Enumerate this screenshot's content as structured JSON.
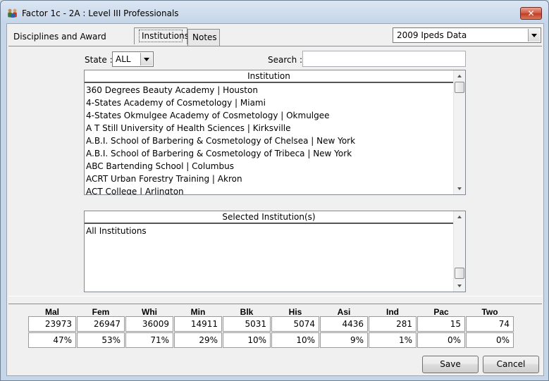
{
  "window": {
    "title": "Factor 1c - 2A : Level III Professionals",
    "close_label": "✕"
  },
  "tabs": [
    {
      "label": "Disciplines and Award Levels",
      "active": false
    },
    {
      "label": "Institutions",
      "active": true
    },
    {
      "label": "Notes",
      "active": false
    }
  ],
  "dataset_select": {
    "value": "2009 Ipeds Data"
  },
  "filters": {
    "state_label": "State :",
    "state_value": "ALL",
    "search_label": "Search :",
    "search_value": ""
  },
  "institutions": {
    "header": "Institution",
    "items": [
      "360 Degrees Beauty Academy | Houston",
      "4-States Academy of Cosmetology | Miami",
      "4-States Okmulgee Academy of Cosmetology | Okmulgee",
      "A T Still University of Health Sciences | Kirksville",
      "A.B.I. School of Barbering & Cosmetology of Chelsea | New York",
      "A.B.I. School of Barbering & Cosmetology of Tribeca | New York",
      "ABC Bartending School | Columbus",
      "ACRT Urban Forestry Training | Akron",
      "ACT College | Arlington"
    ]
  },
  "selected": {
    "header": "Selected Institution(s)",
    "items": [
      "All Institutions"
    ]
  },
  "stats": [
    {
      "label": "Mal",
      "value": "23973",
      "pct": "47%"
    },
    {
      "label": "Fem",
      "value": "26947",
      "pct": "53%"
    },
    {
      "label": "Whi",
      "value": "36009",
      "pct": "71%"
    },
    {
      "label": "Min",
      "value": "14911",
      "pct": "29%"
    },
    {
      "label": "Blk",
      "value": "5031",
      "pct": "10%"
    },
    {
      "label": "His",
      "value": "5074",
      "pct": "10%"
    },
    {
      "label": "Asi",
      "value": "4436",
      "pct": "9%"
    },
    {
      "label": "Ind",
      "value": "281",
      "pct": "1%"
    },
    {
      "label": "Pac",
      "value": "15",
      "pct": "0%"
    },
    {
      "label": "Two",
      "value": "74",
      "pct": "0%"
    }
  ],
  "buttons": {
    "save": "Save",
    "cancel": "Cancel"
  },
  "colors": {
    "close_button": "#c13b22",
    "window_frame": "#c6d6e9"
  }
}
